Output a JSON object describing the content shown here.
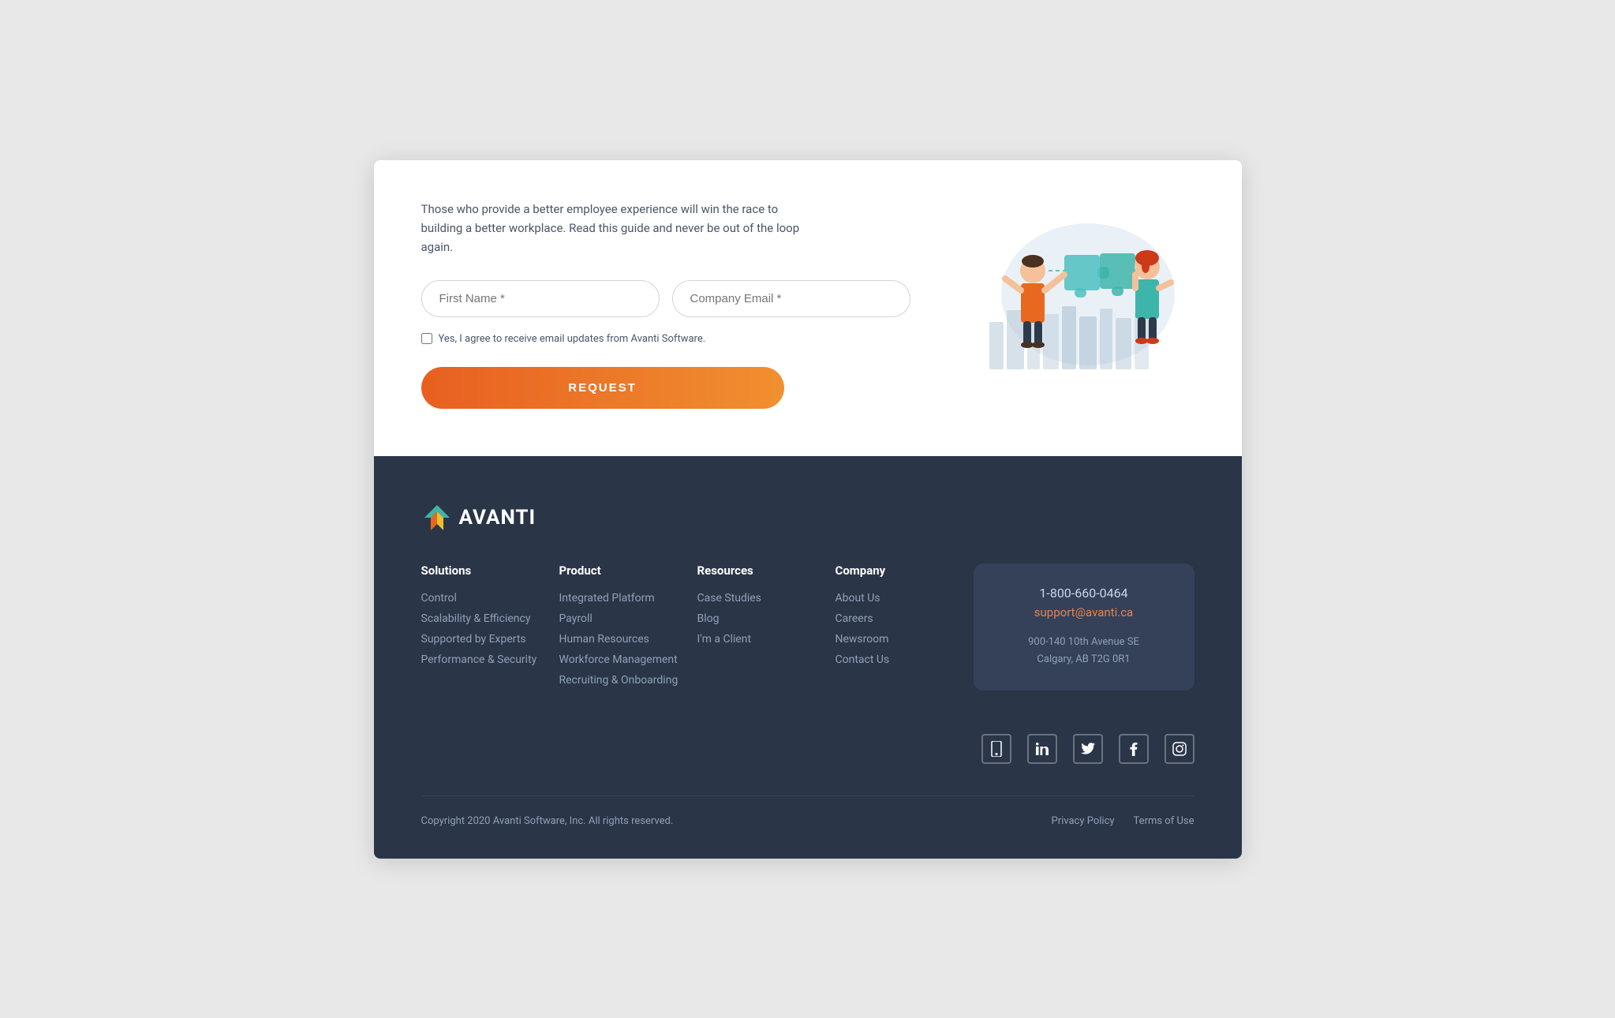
{
  "form": {
    "description": "Those who provide a better employee experience will win the race to building a better workplace. Read this guide and never be out of the loop again.",
    "first_name_placeholder": "First Name *",
    "email_placeholder": "Company Email *",
    "checkbox_label": "Yes, I agree to receive email updates from Avanti Software.",
    "request_button": "REQUEST"
  },
  "footer": {
    "logo_text": "AVANTI",
    "columns": [
      {
        "title": "Solutions",
        "links": [
          "Control",
          "Scalability & Efficiency",
          "Supported by Experts",
          "Performance & Security"
        ]
      },
      {
        "title": "Product",
        "links": [
          "Integrated Platform",
          "Payroll",
          "Human Resources",
          "Workforce Management",
          "Recruiting & Onboarding"
        ]
      },
      {
        "title": "Resources",
        "links": [
          "Case Studies",
          "Blog",
          "I'm a Client"
        ]
      },
      {
        "title": "Company",
        "links": [
          "About Us",
          "Careers",
          "Newsroom",
          "Contact Us"
        ]
      }
    ],
    "contact": {
      "phone": "1-800-660-0464",
      "email": "support@avanti.ca",
      "address_line1": "900-140 10th Avenue SE",
      "address_line2": "Calgary, AB T2G 0R1"
    },
    "social_icons": [
      "mobile-icon",
      "linkedin-icon",
      "twitter-icon",
      "facebook-icon",
      "instagram-icon"
    ],
    "copyright": "Copyright 2020 Avanti Software, Inc. All rights reserved.",
    "policy_links": [
      "Privacy Policy",
      "Terms of Use"
    ]
  }
}
